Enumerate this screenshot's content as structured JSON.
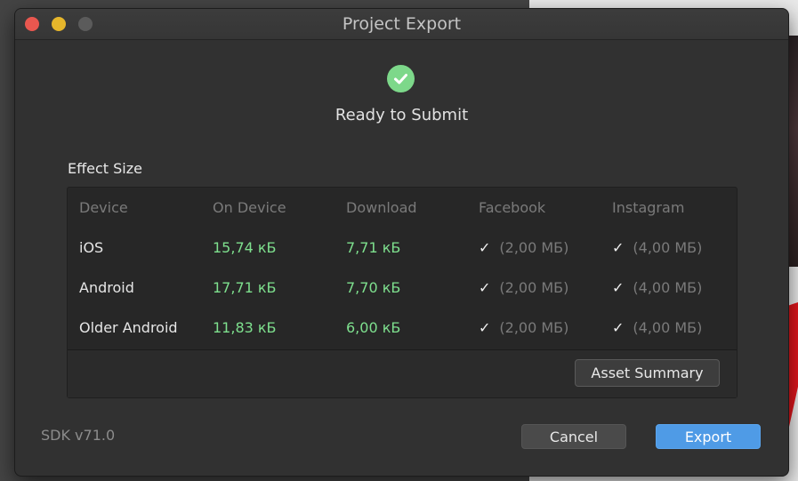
{
  "window": {
    "title": "Project Export"
  },
  "status": {
    "text": "Ready to Submit",
    "icon": "check-circle-icon",
    "color": "#7dd88a"
  },
  "section": {
    "label": "Effect Size"
  },
  "table": {
    "headers": [
      "Device",
      "On Device",
      "Download",
      "Facebook",
      "Instagram"
    ],
    "rows": [
      {
        "device": "iOS",
        "on_device": "15,74 кБ",
        "download": "7,71 кБ",
        "facebook_check": "✓",
        "facebook_limit": "(2,00 МБ)",
        "instagram_check": "✓",
        "instagram_limit": "(4,00 МБ)"
      },
      {
        "device": "Android",
        "on_device": "17,71 кБ",
        "download": "7,70 кБ",
        "facebook_check": "✓",
        "facebook_limit": "(2,00 МБ)",
        "instagram_check": "✓",
        "instagram_limit": "(4,00 МБ)"
      },
      {
        "device": "Older Android",
        "on_device": "11,83 кБ",
        "download": "6,00 кБ",
        "facebook_check": "✓",
        "facebook_limit": "(2,00 МБ)",
        "instagram_check": "✓",
        "instagram_limit": "(4,00 МБ)"
      }
    ],
    "asset_summary_label": "Asset Summary"
  },
  "footer": {
    "sdk_version": "SDK v71.0",
    "cancel_label": "Cancel",
    "export_label": "Export"
  },
  "colors": {
    "size_value": "#7ee08e",
    "export_button": "#4f9be6",
    "close_light": "#e9574f",
    "minimize_light": "#e6b62b"
  }
}
